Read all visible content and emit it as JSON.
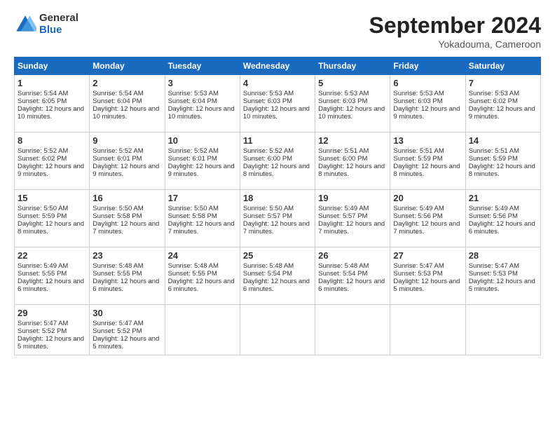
{
  "header": {
    "logo_general": "General",
    "logo_blue": "Blue",
    "month": "September 2024",
    "location": "Yokadouma, Cameroon"
  },
  "days_of_week": [
    "Sunday",
    "Monday",
    "Tuesday",
    "Wednesday",
    "Thursday",
    "Friday",
    "Saturday"
  ],
  "weeks": [
    [
      {
        "day": "1",
        "sunrise": "Sunrise: 5:54 AM",
        "sunset": "Sunset: 6:05 PM",
        "daylight": "Daylight: 12 hours and 10 minutes."
      },
      {
        "day": "2",
        "sunrise": "Sunrise: 5:54 AM",
        "sunset": "Sunset: 6:04 PM",
        "daylight": "Daylight: 12 hours and 10 minutes."
      },
      {
        "day": "3",
        "sunrise": "Sunrise: 5:53 AM",
        "sunset": "Sunset: 6:04 PM",
        "daylight": "Daylight: 12 hours and 10 minutes."
      },
      {
        "day": "4",
        "sunrise": "Sunrise: 5:53 AM",
        "sunset": "Sunset: 6:03 PM",
        "daylight": "Daylight: 12 hours and 10 minutes."
      },
      {
        "day": "5",
        "sunrise": "Sunrise: 5:53 AM",
        "sunset": "Sunset: 6:03 PM",
        "daylight": "Daylight: 12 hours and 10 minutes."
      },
      {
        "day": "6",
        "sunrise": "Sunrise: 5:53 AM",
        "sunset": "Sunset: 6:03 PM",
        "daylight": "Daylight: 12 hours and 9 minutes."
      },
      {
        "day": "7",
        "sunrise": "Sunrise: 5:53 AM",
        "sunset": "Sunset: 6:02 PM",
        "daylight": "Daylight: 12 hours and 9 minutes."
      }
    ],
    [
      {
        "day": "8",
        "sunrise": "Sunrise: 5:52 AM",
        "sunset": "Sunset: 6:02 PM",
        "daylight": "Daylight: 12 hours and 9 minutes."
      },
      {
        "day": "9",
        "sunrise": "Sunrise: 5:52 AM",
        "sunset": "Sunset: 6:01 PM",
        "daylight": "Daylight: 12 hours and 9 minutes."
      },
      {
        "day": "10",
        "sunrise": "Sunrise: 5:52 AM",
        "sunset": "Sunset: 6:01 PM",
        "daylight": "Daylight: 12 hours and 9 minutes."
      },
      {
        "day": "11",
        "sunrise": "Sunrise: 5:52 AM",
        "sunset": "Sunset: 6:00 PM",
        "daylight": "Daylight: 12 hours and 8 minutes."
      },
      {
        "day": "12",
        "sunrise": "Sunrise: 5:51 AM",
        "sunset": "Sunset: 6:00 PM",
        "daylight": "Daylight: 12 hours and 8 minutes."
      },
      {
        "day": "13",
        "sunrise": "Sunrise: 5:51 AM",
        "sunset": "Sunset: 5:59 PM",
        "daylight": "Daylight: 12 hours and 8 minutes."
      },
      {
        "day": "14",
        "sunrise": "Sunrise: 5:51 AM",
        "sunset": "Sunset: 5:59 PM",
        "daylight": "Daylight: 12 hours and 8 minutes."
      }
    ],
    [
      {
        "day": "15",
        "sunrise": "Sunrise: 5:50 AM",
        "sunset": "Sunset: 5:59 PM",
        "daylight": "Daylight: 12 hours and 8 minutes."
      },
      {
        "day": "16",
        "sunrise": "Sunrise: 5:50 AM",
        "sunset": "Sunset: 5:58 PM",
        "daylight": "Daylight: 12 hours and 7 minutes."
      },
      {
        "day": "17",
        "sunrise": "Sunrise: 5:50 AM",
        "sunset": "Sunset: 5:58 PM",
        "daylight": "Daylight: 12 hours and 7 minutes."
      },
      {
        "day": "18",
        "sunrise": "Sunrise: 5:50 AM",
        "sunset": "Sunset: 5:57 PM",
        "daylight": "Daylight: 12 hours and 7 minutes."
      },
      {
        "day": "19",
        "sunrise": "Sunrise: 5:49 AM",
        "sunset": "Sunset: 5:57 PM",
        "daylight": "Daylight: 12 hours and 7 minutes."
      },
      {
        "day": "20",
        "sunrise": "Sunrise: 5:49 AM",
        "sunset": "Sunset: 5:56 PM",
        "daylight": "Daylight: 12 hours and 7 minutes."
      },
      {
        "day": "21",
        "sunrise": "Sunrise: 5:49 AM",
        "sunset": "Sunset: 5:56 PM",
        "daylight": "Daylight: 12 hours and 6 minutes."
      }
    ],
    [
      {
        "day": "22",
        "sunrise": "Sunrise: 5:49 AM",
        "sunset": "Sunset: 5:55 PM",
        "daylight": "Daylight: 12 hours and 6 minutes."
      },
      {
        "day": "23",
        "sunrise": "Sunrise: 5:48 AM",
        "sunset": "Sunset: 5:55 PM",
        "daylight": "Daylight: 12 hours and 6 minutes."
      },
      {
        "day": "24",
        "sunrise": "Sunrise: 5:48 AM",
        "sunset": "Sunset: 5:55 PM",
        "daylight": "Daylight: 12 hours and 6 minutes."
      },
      {
        "day": "25",
        "sunrise": "Sunrise: 5:48 AM",
        "sunset": "Sunset: 5:54 PM",
        "daylight": "Daylight: 12 hours and 6 minutes."
      },
      {
        "day": "26",
        "sunrise": "Sunrise: 5:48 AM",
        "sunset": "Sunset: 5:54 PM",
        "daylight": "Daylight: 12 hours and 6 minutes."
      },
      {
        "day": "27",
        "sunrise": "Sunrise: 5:47 AM",
        "sunset": "Sunset: 5:53 PM",
        "daylight": "Daylight: 12 hours and 5 minutes."
      },
      {
        "day": "28",
        "sunrise": "Sunrise: 5:47 AM",
        "sunset": "Sunset: 5:53 PM",
        "daylight": "Daylight: 12 hours and 5 minutes."
      }
    ],
    [
      {
        "day": "29",
        "sunrise": "Sunrise: 5:47 AM",
        "sunset": "Sunset: 5:52 PM",
        "daylight": "Daylight: 12 hours and 5 minutes."
      },
      {
        "day": "30",
        "sunrise": "Sunrise: 5:47 AM",
        "sunset": "Sunset: 5:52 PM",
        "daylight": "Daylight: 12 hours and 5 minutes."
      },
      {
        "day": "",
        "sunrise": "",
        "sunset": "",
        "daylight": ""
      },
      {
        "day": "",
        "sunrise": "",
        "sunset": "",
        "daylight": ""
      },
      {
        "day": "",
        "sunrise": "",
        "sunset": "",
        "daylight": ""
      },
      {
        "day": "",
        "sunrise": "",
        "sunset": "",
        "daylight": ""
      },
      {
        "day": "",
        "sunrise": "",
        "sunset": "",
        "daylight": ""
      }
    ]
  ]
}
